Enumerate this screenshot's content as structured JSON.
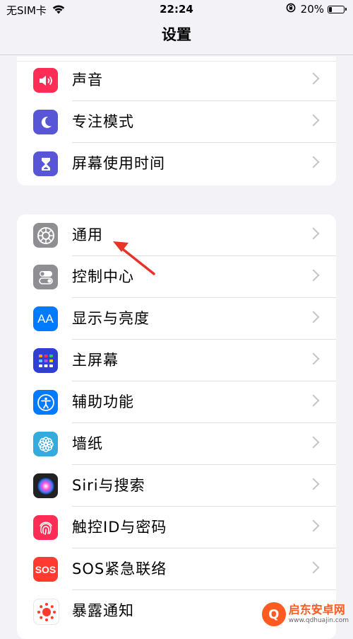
{
  "status_bar": {
    "carrier": "无SIM卡",
    "time": "22:24",
    "battery": "20%",
    "battery_level": 0.2
  },
  "nav": {
    "title": "设置"
  },
  "group1": [
    {
      "label": "声音",
      "icon": "speaker-icon",
      "color": "#ff2d55"
    },
    {
      "label": "专注模式",
      "icon": "moon-icon",
      "color": "#5856d6"
    },
    {
      "label": "屏幕使用时间",
      "icon": "hourglass-icon",
      "color": "#5856d6"
    }
  ],
  "group2": [
    {
      "label": "通用",
      "icon": "gear-icon",
      "color": "#8e8e93"
    },
    {
      "label": "控制中心",
      "icon": "toggles-icon",
      "color": "#8e8e93"
    },
    {
      "label": "显示与亮度",
      "icon": "text-size-icon",
      "color": "#007aff"
    },
    {
      "label": "主屏幕",
      "icon": "home-grid-icon",
      "color": "#2f3fd6"
    },
    {
      "label": "辅助功能",
      "icon": "accessibility-icon",
      "color": "#007aff"
    },
    {
      "label": "墙纸",
      "icon": "flower-icon",
      "color": "#35aadc"
    },
    {
      "label": "Siri与搜索",
      "icon": "siri-icon",
      "color": "#222222"
    },
    {
      "label": "触控ID与密码",
      "icon": "fingerprint-icon",
      "color": "#ff2d55"
    },
    {
      "label": "SOS紧急联络",
      "icon": "sos-icon",
      "color": "#ff3b30"
    },
    {
      "label": "暴露通知",
      "icon": "exposure-icon",
      "color": "#ffffff"
    }
  ],
  "icon_text": {
    "display": "AA",
    "sos": "SOS"
  },
  "watermark": {
    "name": "启东安卓网",
    "url": "www.qdhuajin.com",
    "logo": "Q"
  },
  "annotation_color": "#e8332a"
}
